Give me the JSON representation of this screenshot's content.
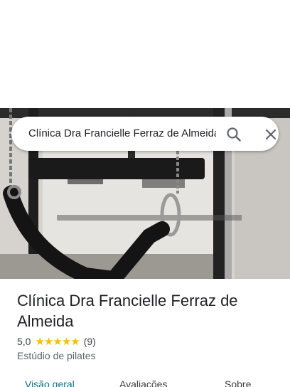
{
  "search": {
    "query": "Clínica Dra Francielle Ferraz de Almeida"
  },
  "place": {
    "name": "Clínica Dra Francielle Ferraz de Almeida",
    "rating": "5,0",
    "review_count": "(9)",
    "stars": 5,
    "category": "Estúdio de pilates"
  },
  "tabs": [
    {
      "label": "Visão geral",
      "active": true
    },
    {
      "label": "Avaliações",
      "active": false
    },
    {
      "label": "Sobre",
      "active": false
    }
  ],
  "colors": {
    "accent": "#0b7285",
    "star": "#fbbc04",
    "text": "#202124",
    "secondary_text": "#5f6368"
  },
  "icons": {
    "search": "search-icon",
    "close": "close-icon",
    "star": "star-icon"
  }
}
